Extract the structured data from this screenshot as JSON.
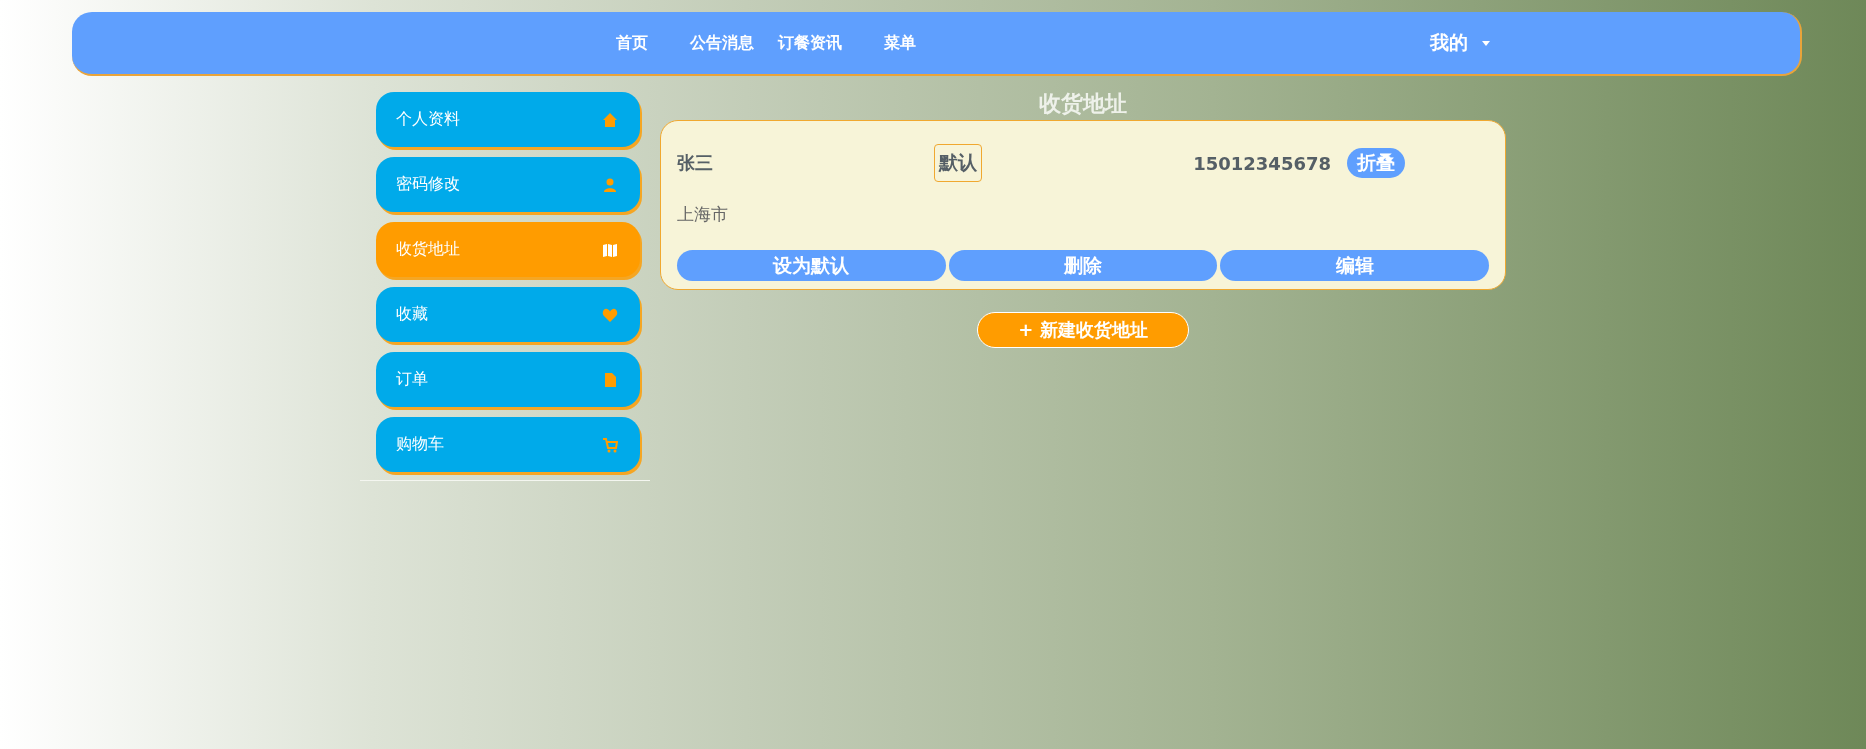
{
  "nav": {
    "items": [
      {
        "label": "首页"
      },
      {
        "label": "公告消息"
      },
      {
        "label": "订餐资讯"
      },
      {
        "label": "菜单"
      }
    ],
    "user_menu": {
      "label": "我的"
    }
  },
  "sidebar": {
    "items": [
      {
        "label": "个人资料",
        "selected": false
      },
      {
        "label": "密码修改",
        "selected": false
      },
      {
        "label": "收货地址",
        "selected": true
      },
      {
        "label": "收藏",
        "selected": false
      },
      {
        "label": "订单",
        "selected": false
      },
      {
        "label": "购物车",
        "selected": false
      }
    ]
  },
  "content": {
    "title": "收货地址",
    "addresses": [
      {
        "name": "张三",
        "default_label": "默认",
        "phone": "15012345678",
        "collapse_button": "折叠",
        "address": "上海市",
        "actions": [
          "设为默认",
          "删除",
          "编辑"
        ]
      }
    ],
    "new_button": "+ 新建收货地址"
  }
}
